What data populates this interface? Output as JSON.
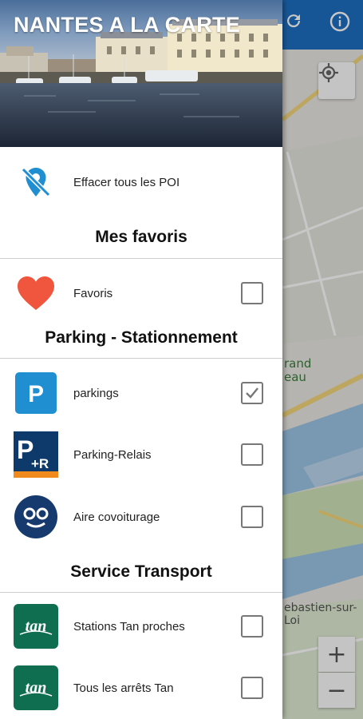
{
  "header": {
    "title": "NANTES A LA CARTE"
  },
  "actions": {
    "clear_poi_label": "Effacer tous les POI"
  },
  "sections": [
    {
      "title": "Mes favoris",
      "items": [
        {
          "label": "Favoris",
          "icon": "heart-icon",
          "checked": false
        }
      ]
    },
    {
      "title": "Parking - Stationnement",
      "items": [
        {
          "label": "parkings",
          "icon": "parking-icon",
          "checked": true
        },
        {
          "label": "Parking-Relais",
          "icon": "parking-relais-icon",
          "checked": false
        },
        {
          "label": "Aire covoiturage",
          "icon": "carpool-icon",
          "checked": false
        }
      ]
    },
    {
      "title": "Service Transport",
      "items": [
        {
          "label": "Stations Tan proches",
          "icon": "tan-logo-icon",
          "checked": false
        },
        {
          "label": "Tous les arrêts Tan",
          "icon": "tan-logo-icon",
          "checked": false
        }
      ]
    }
  ],
  "map": {
    "labels": [
      "rand",
      "eau",
      "ebastien-sur-Loi"
    ],
    "zoom_in": "+",
    "zoom_out": "−"
  },
  "icons": {
    "tan_text": "tan",
    "parking_letter": "P",
    "relais_text": "+R"
  },
  "colors": {
    "accent": "#1e6fc0",
    "heart": "#f0553d",
    "parking_blue": "#1f8fd1",
    "relais_navy": "#0e3a6b",
    "relais_orange": "#f08a1c",
    "carpool_navy": "#173a6e",
    "tan_green": "#0f6e4f"
  }
}
